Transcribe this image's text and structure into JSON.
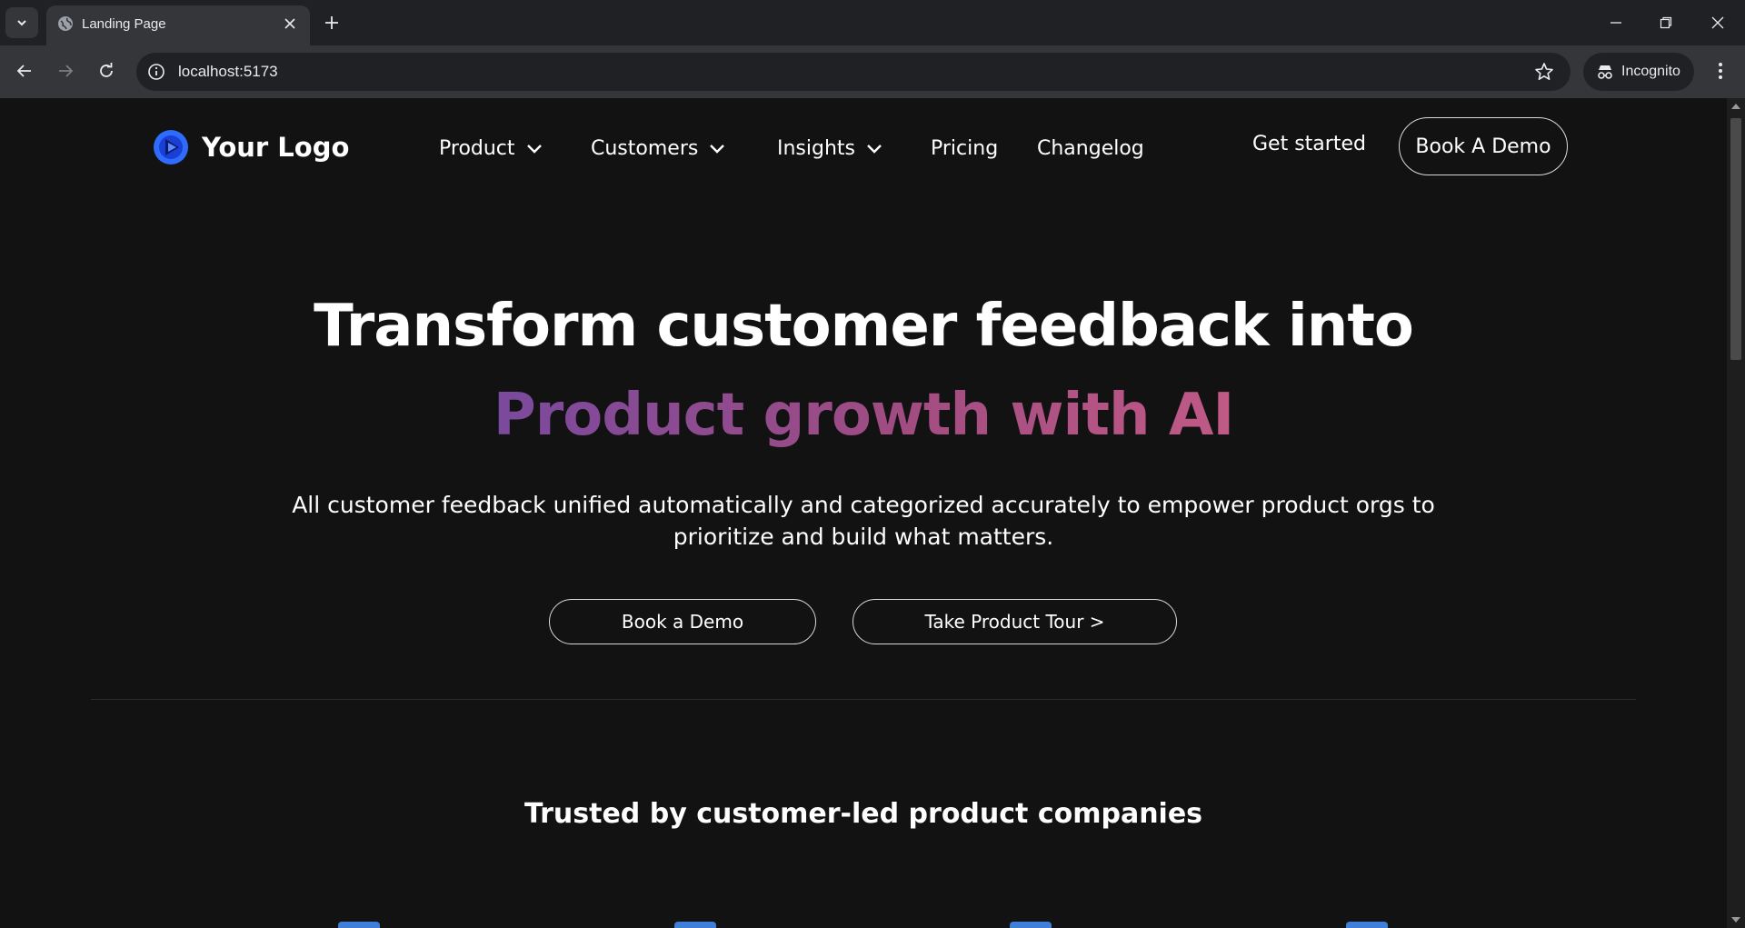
{
  "browser": {
    "tab_title": "Landing Page",
    "url": "localhost:5173",
    "incognito_label": "Incognito"
  },
  "header": {
    "logo_text": "Your Logo",
    "nav": [
      {
        "label": "Product",
        "has_dropdown": true
      },
      {
        "label": "Customers",
        "has_dropdown": true
      },
      {
        "label": "Insights",
        "has_dropdown": true
      },
      {
        "label": "Pricing",
        "has_dropdown": false
      },
      {
        "label": "Changelog",
        "has_dropdown": false
      }
    ],
    "get_started": "Get started",
    "book_demo": "Book A Demo"
  },
  "hero": {
    "title": "Transform customer feedback into",
    "subtitle": "Product growth with AI",
    "description": "All customer feedback unified automatically and categorized accurately to empower product orgs to prioritize and build what matters.",
    "primary_cta": "Book a Demo",
    "secondary_cta": "Take Product Tour >"
  },
  "trusted": {
    "heading": "Trusted by customer-led product companies"
  },
  "colors": {
    "background": "#121212",
    "gradient_start": "#7a4a9e",
    "gradient_end": "#c05a86",
    "logo_blue": "#2f6bff",
    "company_logo_blue": "#3f7fd9"
  }
}
